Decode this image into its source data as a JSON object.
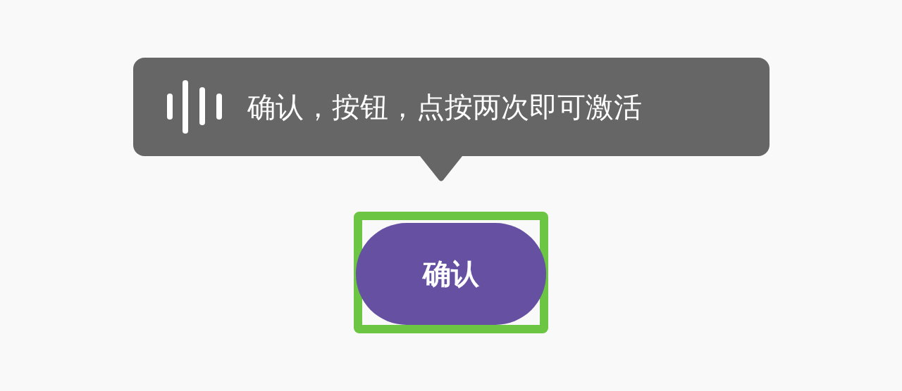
{
  "tooltip": {
    "text": "确认，按钮，点按两次即可激活"
  },
  "button": {
    "label": "确认",
    "focused": true
  }
}
